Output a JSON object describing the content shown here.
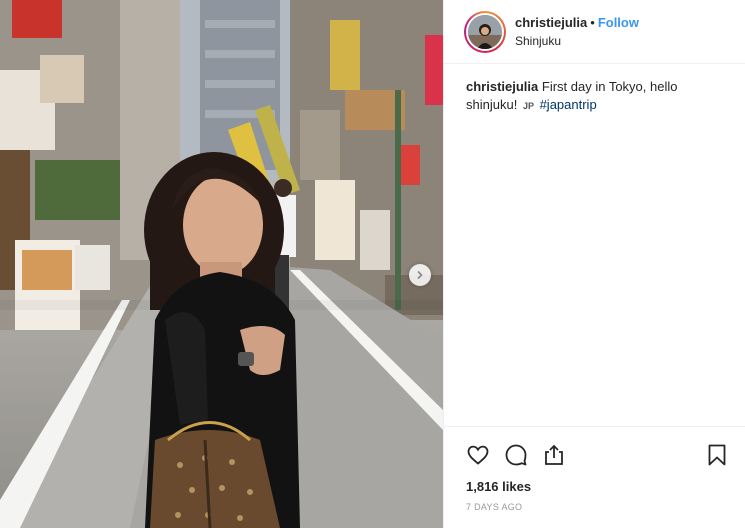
{
  "post": {
    "username": "christiejulia",
    "separator": "•",
    "follow_label": "Follow",
    "location": "Shinjuku",
    "caption": {
      "username": "christiejulia",
      "text": "First day in Tokyo, hello shinjuku!",
      "flag": "JP",
      "hashtag": "#japantrip"
    },
    "likes": "1,816 likes",
    "timestamp": "7 DAYS AGO"
  },
  "icons": {
    "like": "heart-outline-icon",
    "comment": "comment-bubble-icon",
    "share": "share-arrow-icon",
    "save": "bookmark-icon",
    "next": "chevron-right-icon"
  },
  "colors": {
    "accent": "#3897f0",
    "hashtag": "#003569",
    "text": "#262626",
    "muted": "#999999",
    "divider": "#efefef"
  }
}
